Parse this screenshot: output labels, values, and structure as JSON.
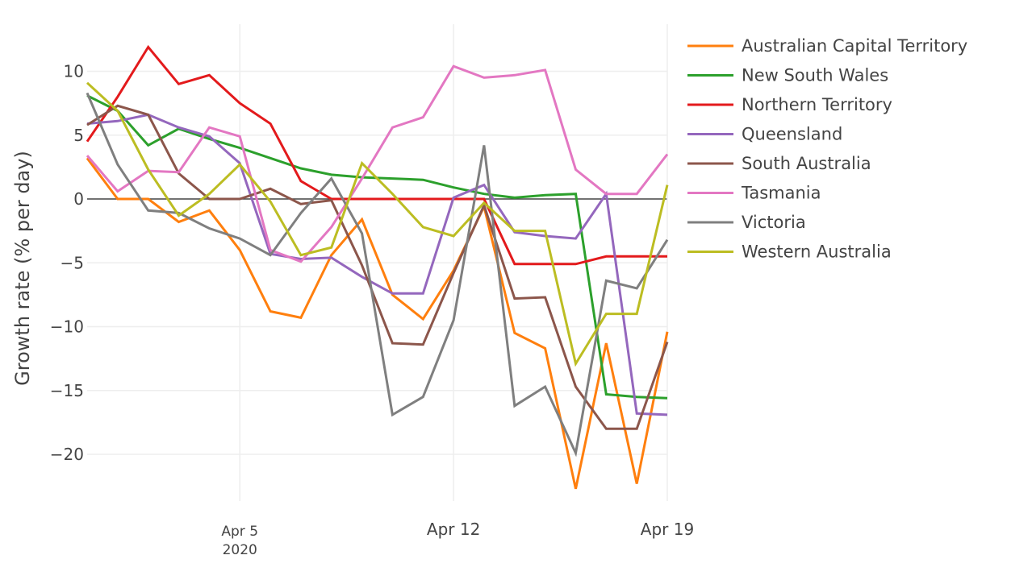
{
  "chart_data": {
    "type": "line",
    "title": "",
    "xlabel": "",
    "ylabel": "Growth rate (% per day)",
    "x": [
      "2020-03-31",
      "2020-04-01",
      "2020-04-02",
      "2020-04-03",
      "2020-04-04",
      "2020-04-05",
      "2020-04-06",
      "2020-04-07",
      "2020-04-08",
      "2020-04-09",
      "2020-04-10",
      "2020-04-11",
      "2020-04-12",
      "2020-04-13",
      "2020-04-14",
      "2020-04-15",
      "2020-04-16",
      "2020-04-17",
      "2020-04-18",
      "2020-04-19"
    ],
    "xticks": [
      {
        "x": "2020-04-05",
        "label": "Apr 5",
        "sublabel": "2020"
      },
      {
        "x": "2020-04-12",
        "label": "Apr 12",
        "sublabel": ""
      },
      {
        "x": "2020-04-19",
        "label": "Apr 19",
        "sublabel": ""
      }
    ],
    "yticks": [
      10,
      5,
      0,
      -5,
      -10,
      -15,
      -20
    ],
    "ytick_labels": [
      "10",
      "5",
      "0",
      "−5",
      "−10",
      "−15",
      "−20"
    ],
    "ylim": [
      -24,
      13.5
    ],
    "grid": true,
    "legend_position": "right",
    "series": [
      {
        "name": "Australian Capital Territory",
        "color": "#ff7f0e",
        "values": [
          3.2,
          0,
          0,
          -1.8,
          -0.9,
          -4.0,
          -8.8,
          -9.3,
          -4.4,
          -1.6,
          -7.5,
          -9.4,
          -5.6,
          -0.6,
          -10.5,
          -11.7,
          -22.7,
          -11.3,
          -22.3,
          -10.4
        ]
      },
      {
        "name": "New South Wales",
        "color": "#2ca02c",
        "values": [
          8.1,
          6.9,
          4.2,
          5.5,
          4.7,
          4.0,
          3.2,
          2.4,
          1.9,
          1.7,
          1.6,
          1.5,
          0.9,
          0.4,
          0.1,
          0.3,
          0.4,
          -15.3,
          -15.5,
          -15.6
        ]
      },
      {
        "name": "Northern Territory",
        "color": "#e31a1c",
        "values": [
          4.5,
          8.0,
          11.9,
          9.0,
          9.7,
          7.5,
          5.9,
          1.4,
          0,
          0,
          0,
          0,
          0,
          0,
          -5.1,
          -5.1,
          -5.1,
          -4.5,
          -4.5,
          -4.5
        ]
      },
      {
        "name": "Queensland",
        "color": "#9467bd",
        "values": [
          5.9,
          6.1,
          6.6,
          5.6,
          4.9,
          2.8,
          -4.3,
          -4.7,
          -4.6,
          -6.1,
          -7.4,
          -7.4,
          0.1,
          1.1,
          -2.6,
          -2.9,
          -3.1,
          0.4,
          -16.8,
          -16.9
        ]
      },
      {
        "name": "South Australia",
        "color": "#8c564b",
        "values": [
          5.8,
          7.3,
          6.6,
          2.0,
          0,
          0,
          0.8,
          -0.4,
          -0.1,
          -5.2,
          -11.3,
          -11.4,
          -5.8,
          -0.5,
          -7.8,
          -7.7,
          -14.7,
          -18.0,
          -18.0,
          -11.2
        ]
      },
      {
        "name": "Tasmania",
        "color": "#e377c2",
        "values": [
          3.4,
          0.6,
          2.2,
          2.1,
          5.6,
          4.9,
          -4.0,
          -4.9,
          -2.2,
          1.6,
          5.6,
          6.4,
          10.4,
          9.5,
          9.7,
          10.1,
          2.3,
          0.4,
          0.4,
          3.5
        ]
      },
      {
        "name": "Victoria",
        "color": "#7f7f7f",
        "values": [
          8.3,
          2.7,
          -0.9,
          -1.1,
          -2.3,
          -3.1,
          -4.4,
          -1.1,
          1.6,
          -2.7,
          -16.9,
          -15.5,
          -9.5,
          4.2,
          -16.2,
          -14.7,
          -19.9,
          -6.4,
          -7.0,
          -3.2
        ]
      },
      {
        "name": "Western Australia",
        "color": "#bcbd22",
        "values": [
          9.1,
          6.9,
          2.3,
          -1.3,
          0.4,
          2.7,
          -0.2,
          -4.4,
          -3.8,
          2.8,
          0.4,
          -2.2,
          -2.9,
          -0.3,
          -2.5,
          -2.5,
          -12.9,
          -9.0,
          -9.0,
          1.1
        ]
      }
    ]
  }
}
